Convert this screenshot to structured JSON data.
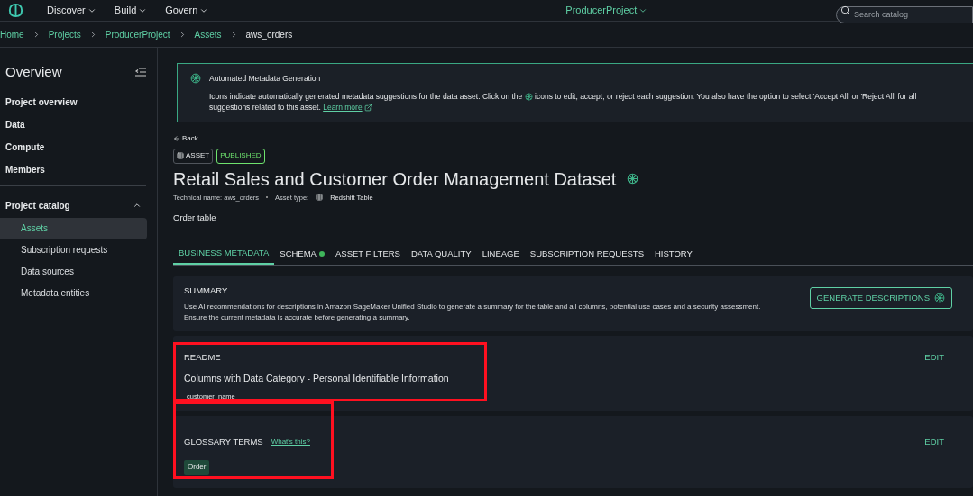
{
  "top_nav": {
    "menus": [
      "Discover",
      "Build",
      "Govern"
    ],
    "project": "ProducerProject",
    "search": {
      "placeholder": "Search catalog"
    }
  },
  "breadcrumb": [
    {
      "label": "Home",
      "link": true
    },
    {
      "label": "Projects",
      "link": true
    },
    {
      "label": "ProducerProject",
      "link": true
    },
    {
      "label": "Assets",
      "link": true
    },
    {
      "label": "aws_orders",
      "link": false
    }
  ],
  "sidebar": {
    "title": "Overview",
    "items": [
      {
        "label": "Project overview"
      },
      {
        "label": "Data"
      },
      {
        "label": "Compute"
      },
      {
        "label": "Members"
      }
    ],
    "section": {
      "label": "Project catalog",
      "expanded": true,
      "children": [
        {
          "label": "Assets",
          "selected": true
        },
        {
          "label": "Subscription requests",
          "selected": false
        },
        {
          "label": "Data sources",
          "selected": false
        },
        {
          "label": "Metadata entities",
          "selected": false
        }
      ]
    }
  },
  "banner": {
    "title": "Automated Metadata Generation",
    "text_before": "Icons indicate automatically generated metadata suggestions for the data asset. Click on the",
    "text_after": "icons to edit, accept, or reject each suggestion. You also have the option to select 'Accept All' or 'Reject All' for all",
    "text_line2": "suggestions related to this asset.",
    "link": "Learn more"
  },
  "back": "Back",
  "badges": {
    "type": "ASSET",
    "status": "PUBLISHED"
  },
  "title": "Retail Sales and Customer Order Management Dataset",
  "technical_name": "Technical name: aws_orders",
  "asset_type_label": "Asset type:",
  "asset_type": "Redshift Table",
  "description": "Order table",
  "tabs": [
    {
      "label": "BUSINESS METADATA",
      "selected": true,
      "dot": false
    },
    {
      "label": "SCHEMA",
      "selected": false,
      "dot": true
    },
    {
      "label": "ASSET FILTERS",
      "selected": false,
      "dot": false
    },
    {
      "label": "DATA QUALITY",
      "selected": false,
      "dot": false
    },
    {
      "label": "LINEAGE",
      "selected": false,
      "dot": false
    },
    {
      "label": "SUBSCRIPTION REQUESTS",
      "selected": false,
      "dot": false
    },
    {
      "label": "HISTORY",
      "selected": false,
      "dot": false
    }
  ],
  "summary": {
    "title": "SUMMARY",
    "text": "Use AI recommendations for descriptions in Amazon SageMaker Unified Studio to generate a summary for the table and all columns, potential use cases and a security assessment. Ensure the current metadata is accurate before generating a summary.",
    "button": "GENERATE DESCRIPTIONS"
  },
  "readme": {
    "title": "README",
    "heading": "Columns with Data Category - Personal Identifiable Information",
    "item": "customer_name",
    "edit": "EDIT",
    "highlighted": true
  },
  "glossary": {
    "title": "GLOSSARY TERMS",
    "help": "What's this?",
    "terms": [
      "Order"
    ],
    "edit": "EDIT",
    "highlighted": true
  }
}
